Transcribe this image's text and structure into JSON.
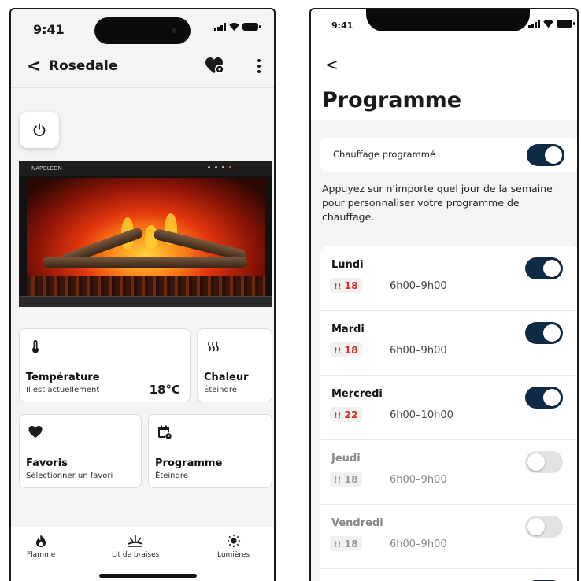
{
  "left_screen": {
    "status": {
      "time": "9:41"
    },
    "header": {
      "title": "Rosedale"
    },
    "fireplace_brand": "NAPOLEON",
    "tiles": {
      "temperature": {
        "title": "Température",
        "subtitle": "Il est actuellement",
        "value": "18°C"
      },
      "heat": {
        "title": "Chaleur",
        "subtitle": "Éteindre"
      },
      "favorites": {
        "title": "Favoris",
        "subtitle": "Sélectionner un favori"
      },
      "schedule": {
        "title": "Programme",
        "subtitle": "Éteindre"
      }
    },
    "tabs": [
      {
        "label": "Flamme",
        "icon": "flame-icon"
      },
      {
        "label": "Lit de braises",
        "icon": "ember-bed-icon"
      },
      {
        "label": "Lumières",
        "icon": "sun-icon"
      }
    ]
  },
  "right_screen": {
    "status": {
      "time": "9:41"
    },
    "title": "Programme",
    "scheduled_heating": {
      "label": "Chauffage programmé",
      "on": true
    },
    "description": "Appuyez sur n'importe quel jour de la semaine pour personnaliser votre programme de chauffage.",
    "days": [
      {
        "name": "Lundi",
        "temp": "18",
        "time": "6h00–9h00",
        "on": true
      },
      {
        "name": "Mardi",
        "temp": "18",
        "time": "6h00–9h00",
        "on": true
      },
      {
        "name": "Mercredi",
        "temp": "22",
        "time": "6h00–10h00",
        "on": true
      },
      {
        "name": "Jeudi",
        "temp": "18",
        "time": "6h00–9h00",
        "on": false
      },
      {
        "name": "Vendredi",
        "temp": "18",
        "time": "6h00–9h00",
        "on": false
      }
    ]
  },
  "colors": {
    "accent_navy": "#0f2a44",
    "heat_red": "#d6302a",
    "toggle_off": "#e2e2e2"
  }
}
